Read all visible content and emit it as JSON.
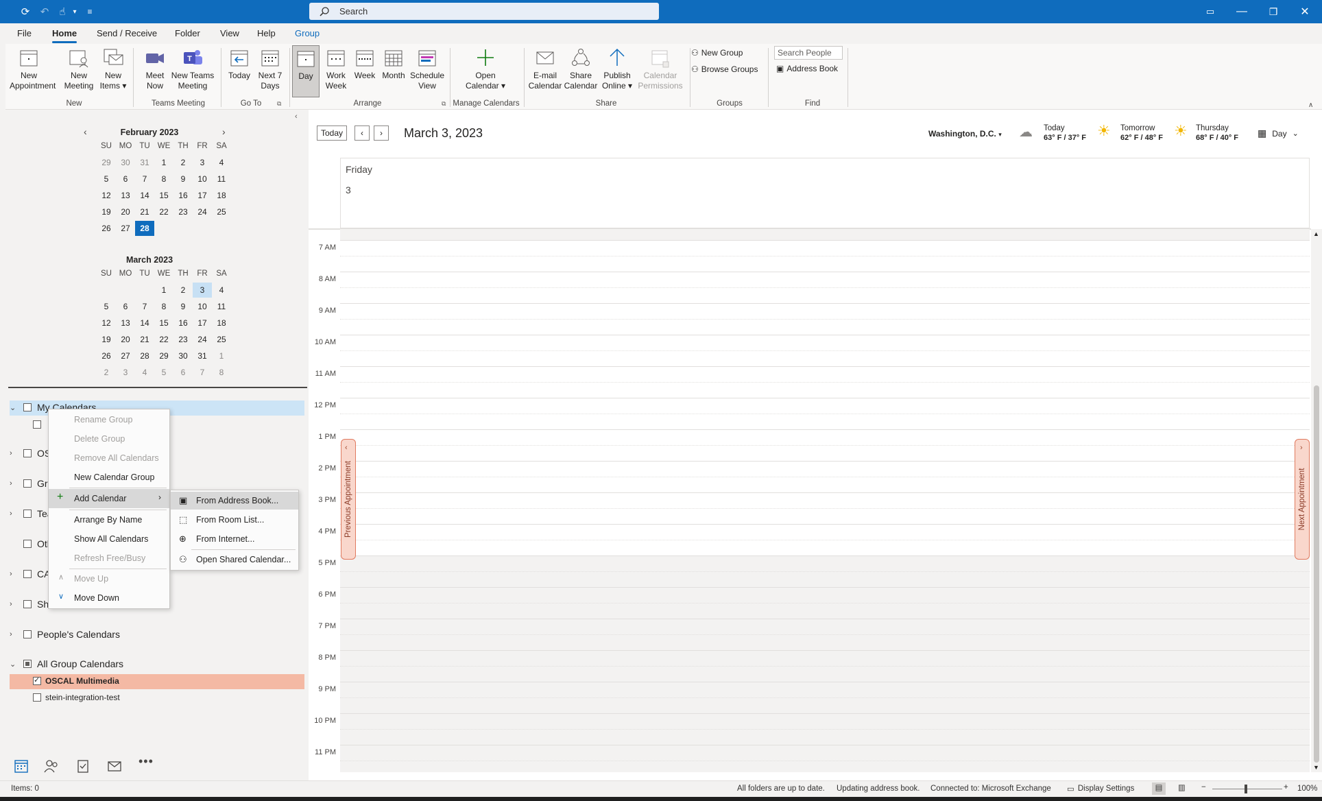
{
  "titlebar": {
    "search_placeholder": "Search"
  },
  "menu": {
    "items": [
      "File",
      "Home",
      "Send / Receive",
      "Folder",
      "View",
      "Help",
      "Group"
    ],
    "active": "Home",
    "contextual": "Group"
  },
  "ribbon": {
    "new_appointment": "New Appointment",
    "new_meeting": "New Meeting",
    "new_items": "New Items",
    "group_new": "New",
    "meet_now": "Meet Now",
    "new_teams_meeting": "New Teams Meeting",
    "group_teams": "Teams Meeting",
    "today": "Today",
    "next_7_days": "Next 7 Days",
    "group_goto": "Go To",
    "day": "Day",
    "work_week": "Work Week",
    "week": "Week",
    "month": "Month",
    "schedule_view": "Schedule View",
    "group_arrange": "Arrange",
    "open_calendar": "Open Calendar",
    "group_manage": "Manage Calendars",
    "email_calendar": "E-mail Calendar",
    "share_calendar": "Share Calendar",
    "publish_online": "Publish Online",
    "calendar_permissions": "Calendar Permissions",
    "group_share": "Share",
    "new_group": "New Group",
    "browse_groups": "Browse Groups",
    "group_groups": "Groups",
    "search_people": "Search People",
    "address_book": "Address Book",
    "group_find": "Find"
  },
  "feb": {
    "title": "February 2023",
    "dow": [
      "SU",
      "MO",
      "TU",
      "WE",
      "TH",
      "FR",
      "SA"
    ],
    "weeks": [
      [
        "29",
        "30",
        "31",
        "1",
        "2",
        "3",
        "4"
      ],
      [
        "5",
        "6",
        "7",
        "8",
        "9",
        "10",
        "11"
      ],
      [
        "12",
        "13",
        "14",
        "15",
        "16",
        "17",
        "18"
      ],
      [
        "19",
        "20",
        "21",
        "22",
        "23",
        "24",
        "25"
      ],
      [
        "26",
        "27",
        "28",
        "",
        "",
        "",
        ""
      ]
    ],
    "today": "28"
  },
  "mar": {
    "title": "March 2023",
    "dow": [
      "SU",
      "MO",
      "TU",
      "WE",
      "TH",
      "FR",
      "SA"
    ],
    "weeks": [
      [
        "",
        "",
        "",
        "1",
        "2",
        "3",
        "4"
      ],
      [
        "5",
        "6",
        "7",
        "8",
        "9",
        "10",
        "11"
      ],
      [
        "12",
        "13",
        "14",
        "15",
        "16",
        "17",
        "18"
      ],
      [
        "19",
        "20",
        "21",
        "22",
        "23",
        "24",
        "25"
      ],
      [
        "26",
        "27",
        "28",
        "29",
        "30",
        "31",
        "1"
      ],
      [
        "2",
        "3",
        "4",
        "5",
        "6",
        "7",
        "8"
      ]
    ],
    "selected": "3"
  },
  "groups": {
    "my_calendars": "My Calendars",
    "partial_labels": [
      "OSC",
      "Gro",
      "Tea",
      "Oth",
      "CAL",
      "Sha"
    ],
    "peoples_calendars": "People's Calendars",
    "all_group_calendars": "All Group Calendars",
    "oscal_multimedia": "OSCAL Multimedia",
    "stein": "stein-integration-test"
  },
  "ctx": {
    "rename_group": "Rename Group",
    "delete_group": "Delete Group",
    "remove_all": "Remove All Calendars",
    "new_calendar_group": "New Calendar Group",
    "add_calendar": "Add Calendar",
    "arrange_by_name": "Arrange By Name",
    "show_all": "Show All Calendars",
    "refresh": "Refresh Free/Busy",
    "move_up": "Move Up",
    "move_down": "Move Down"
  },
  "submenu": {
    "from_address_book": "From Address Book...",
    "from_room_list": "From Room List...",
    "from_internet": "From Internet...",
    "open_shared": "Open Shared Calendar..."
  },
  "calendar": {
    "today_btn": "Today",
    "date_title": "March 3, 2023",
    "location": "Washington, D.C.",
    "weather": [
      {
        "day": "Today",
        "temp": "63° F / 37° F"
      },
      {
        "day": "Tomorrow",
        "temp": "62° F / 48° F"
      },
      {
        "day": "Thursday",
        "temp": "68° F / 40° F"
      }
    ],
    "view_mode": "Day",
    "day_name": "Friday",
    "day_number": "3",
    "hours": [
      "7 AM",
      "8 AM",
      "9 AM",
      "10 AM",
      "11 AM",
      "12 PM",
      "1 PM",
      "2 PM",
      "3 PM",
      "4 PM",
      "5 PM",
      "6 PM",
      "7 PM",
      "8 PM",
      "9 PM",
      "10 PM",
      "11 PM"
    ],
    "prev_appt": "Previous Appointment",
    "next_appt": "Next Appointment"
  },
  "status": {
    "items": "Items: 0",
    "sync": "All folders are up to date.",
    "updating": "Updating address book.",
    "connection": "Connected to: Microsoft Exchange",
    "display_settings": "Display Settings",
    "zoom": "100%"
  },
  "colors": {
    "accent": "#0f6cbd",
    "highlight_group": "#f4b9a4",
    "nav_tab": "#e07a5f"
  }
}
